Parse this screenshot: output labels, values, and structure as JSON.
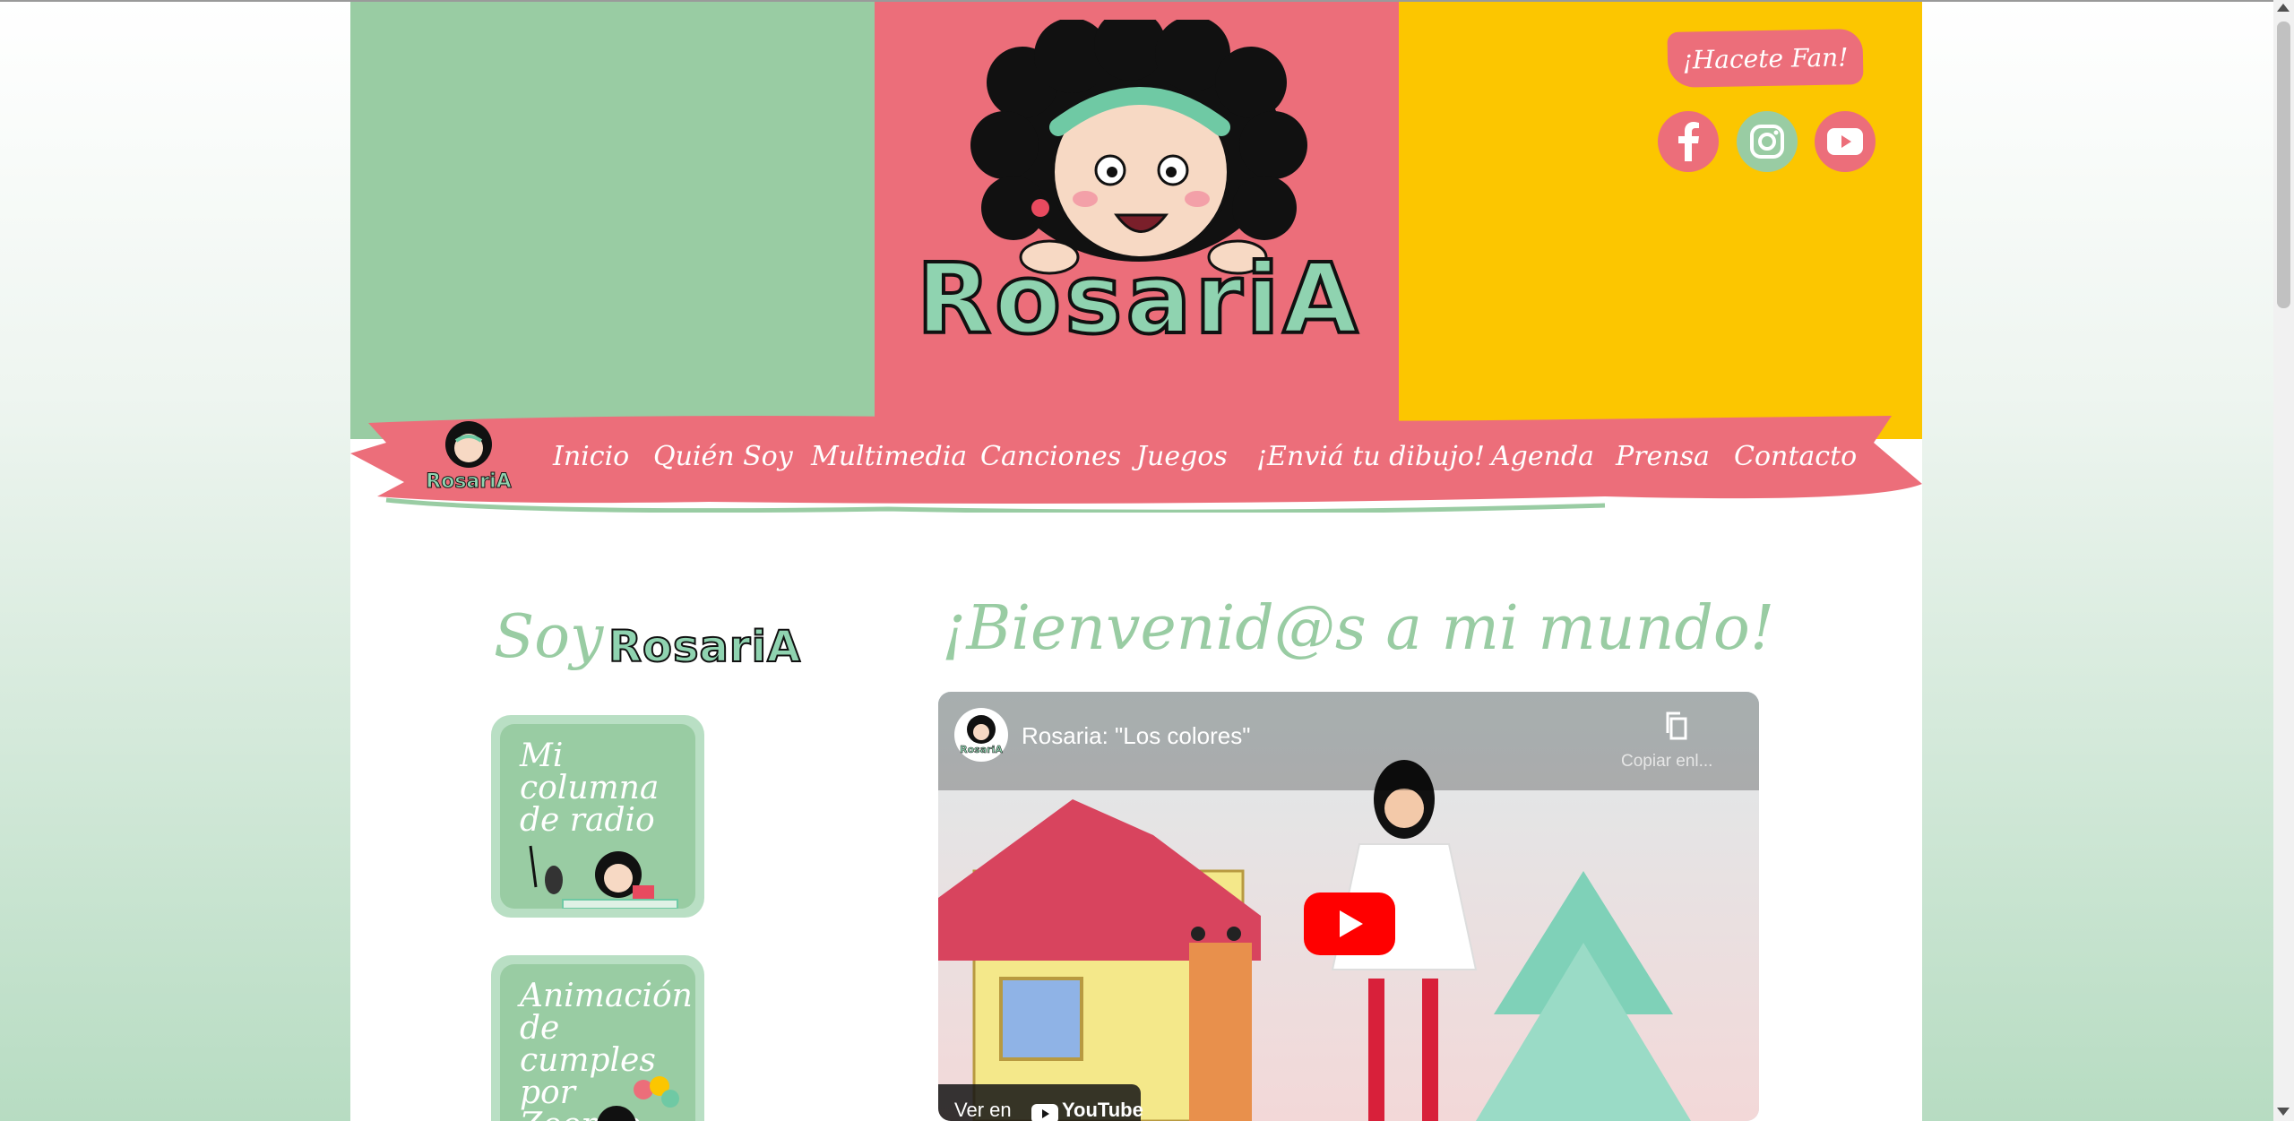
{
  "brand": {
    "name": "RosariA",
    "colors": {
      "green": "#99cca3",
      "pink": "#ec6e7a",
      "yellow": "#fcc600",
      "mint": "#8fd3b0"
    }
  },
  "header": {
    "fan_label": "¡Hacete Fan!",
    "social": [
      {
        "icon": "facebook-icon"
      },
      {
        "icon": "instagram-icon"
      },
      {
        "icon": "youtube-icon"
      }
    ]
  },
  "nav": {
    "items": [
      {
        "label": "Inicio"
      },
      {
        "label": "Quién Soy"
      },
      {
        "label": "Multimedia"
      },
      {
        "label": "Canciones"
      },
      {
        "label": "Juegos"
      },
      {
        "label": "¡Enviá tu dibujo!"
      },
      {
        "label": "Agenda"
      },
      {
        "label": "Prensa"
      },
      {
        "label": "Contacto"
      }
    ]
  },
  "sidebar": {
    "heading_prefix": "Soy",
    "heading_word": "RosariA",
    "cards": [
      {
        "title": "Mi columna de radio"
      },
      {
        "title": "Animación de cumples por Zoom o vivo"
      }
    ]
  },
  "main": {
    "heading": "¡Bienvenid@s a mi mundo!",
    "video": {
      "title": "Rosaria: \"Los colores\"",
      "copy_label": "Copiar enl...",
      "watch_on": "Ver en",
      "platform": "YouTube"
    }
  }
}
